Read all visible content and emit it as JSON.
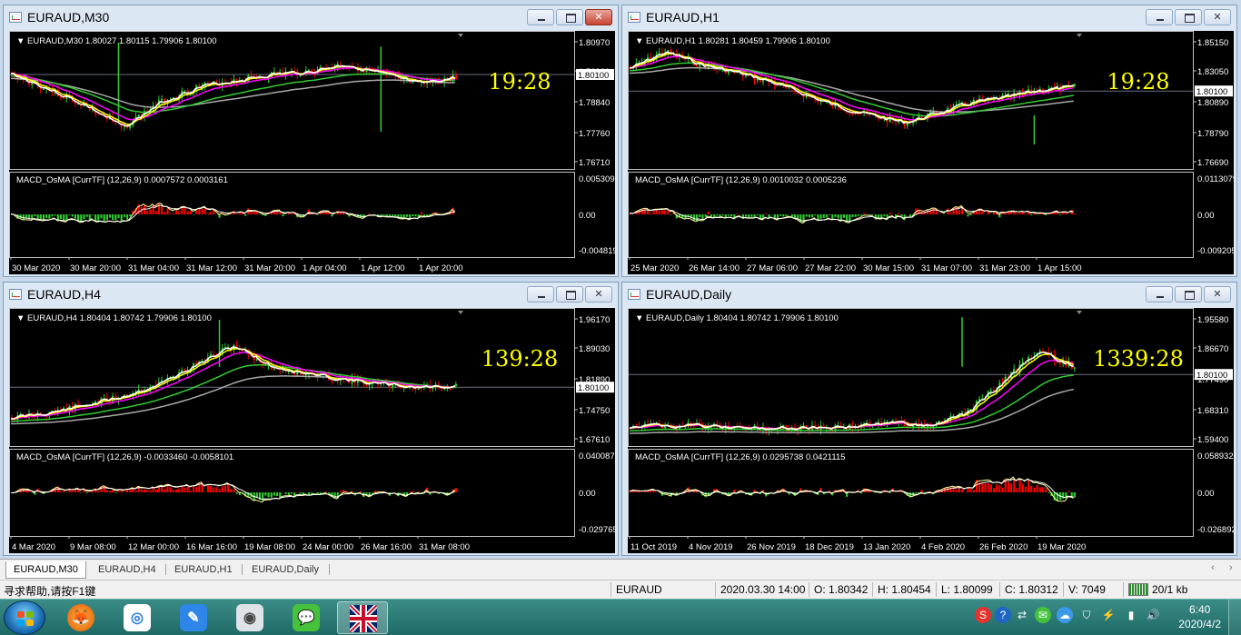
{
  "windows": [
    {
      "id": "m30",
      "title": "EURAUD,M30",
      "close_active": true,
      "info": "EURAUD,M30  1.80027 1.80115 1.79906 1.80100",
      "timer": "19:28",
      "price_ticks": [
        "1.80970",
        "1.79920",
        "1.78840",
        "1.77760",
        "1.76710"
      ],
      "current_price": "1.80100",
      "macd_label": "MACD_OsMA [CurrTF] (12,26,9) 0.0007572 0.0003161",
      "macd_ticks": [
        "0.0053097",
        "0.00",
        "-0.004819"
      ],
      "time_labels": [
        "30 Mar 2020",
        "30 Mar 20:00",
        "31 Mar 04:00",
        "31 Mar 12:00",
        "31 Mar 20:00",
        "1 Apr 04:00",
        "1 Apr 12:00",
        "1 Apr 20:00"
      ]
    },
    {
      "id": "h1",
      "title": "EURAUD,H1",
      "close_active": false,
      "info": "EURAUD,H1  1.80281 1.80459 1.79906 1.80100",
      "timer": "19:28",
      "price_ticks": [
        "1.85150",
        "1.83050",
        "1.80890",
        "1.78790",
        "1.76690"
      ],
      "current_price": "1.80100",
      "macd_label": "MACD_OsMA [CurrTF] (12,26,9) 0.0010032 0.0005236",
      "macd_ticks": [
        "0.0113079",
        "0.00",
        "-0.009205"
      ],
      "time_labels": [
        "25 Mar 2020",
        "26 Mar 14:00",
        "27 Mar 06:00",
        "27 Mar 22:00",
        "30 Mar 15:00",
        "31 Mar 07:00",
        "31 Mar 23:00",
        "1 Apr 15:00"
      ]
    },
    {
      "id": "h4",
      "title": "EURAUD,H4",
      "close_active": false,
      "info": "EURAUD,H4  1.80404 1.80742 1.79906 1.80100",
      "timer": "139:28",
      "price_ticks": [
        "1.96170",
        "1.89030",
        "1.81890",
        "1.74750",
        "1.67610"
      ],
      "current_price": "1.80100",
      "macd_label": "MACD_OsMA [CurrTF] (12,26,9) -0.0033460 -0.0058101",
      "macd_ticks": [
        "0.0400879",
        "0.00",
        "-0.029765"
      ],
      "time_labels": [
        "4 Mar 2020",
        "9 Mar 08:00",
        "12 Mar 00:00",
        "16 Mar 16:00",
        "19 Mar 08:00",
        "24 Mar 00:00",
        "26 Mar 16:00",
        "31 Mar 08:00"
      ]
    },
    {
      "id": "daily",
      "title": "EURAUD,Daily",
      "close_active": false,
      "info": "EURAUD,Daily  1.80404 1.80742 1.79906 1.80100",
      "timer": "1339:28",
      "price_ticks": [
        "1.95580",
        "1.86670",
        "1.77490",
        "1.68310",
        "1.59400"
      ],
      "current_price": "1.80100",
      "macd_label": "MACD_OsMA [CurrTF] (12,26,9) 0.0295738 0.0421115",
      "macd_ticks": [
        "0.0589326",
        "0.00",
        "-0.026892"
      ],
      "time_labels": [
        "11 Oct 2019",
        "4 Nov 2019",
        "26 Nov 2019",
        "18 Dec 2019",
        "13 Jan 2020",
        "4 Feb 2020",
        "26 Feb 2020",
        "19 Mar 2020"
      ]
    }
  ],
  "tabs": [
    "EURAUD,M30",
    "EURAUD,H4",
    "EURAUD,H1",
    "EURAUD,Daily"
  ],
  "status": {
    "help": "寻求帮助,请按F1键",
    "symbol": "EURAUD",
    "datetime": "2020.03.30 14:00",
    "open": "O: 1.80342",
    "high": "H: 1.80454",
    "low": "L: 1.80099",
    "close": "C: 1.80312",
    "volume": "V: 7049",
    "traffic": "20/1 kb"
  },
  "taskbar": {
    "apps": [
      "fox-browser",
      "baidu-netdisk",
      "notes-pen",
      "screenshot-camera",
      "wechat",
      "metatrader"
    ],
    "clock_time": "6:40",
    "clock_date": "2020/4/2"
  },
  "colors": {
    "bull": "#32cd32",
    "bear": "#ff0000",
    "ma_fast": "#ffffff",
    "ma_yellow": "#ffff00",
    "ma_magenta": "#ff00ff",
    "ma_green": "#32cd32",
    "ma_gray": "#a9a9a9",
    "timer": "#ffff00"
  }
}
